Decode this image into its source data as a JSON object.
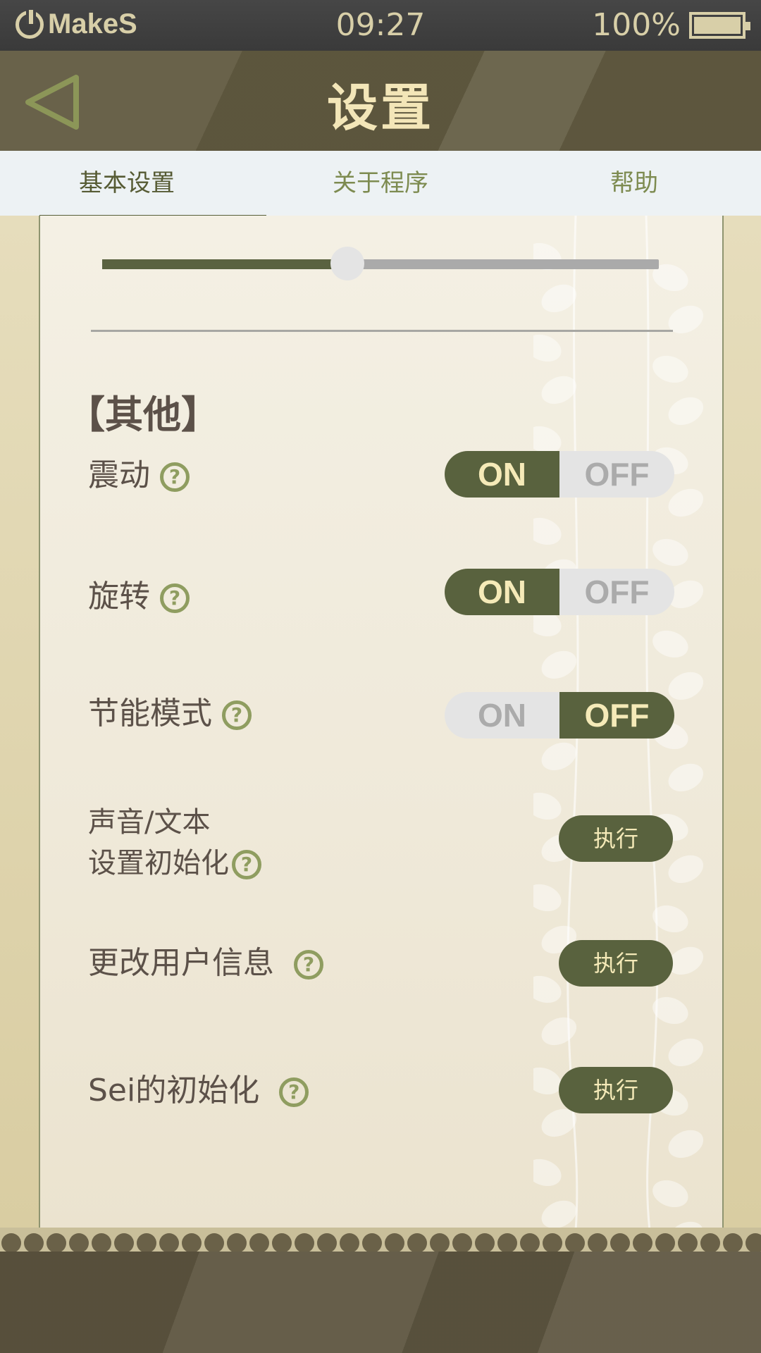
{
  "status_bar": {
    "brand": "MakeS",
    "time": "09:27",
    "battery": "100%",
    "battery_level": 1.0
  },
  "header": {
    "title": "设置",
    "back_icon": "back-triangle-icon"
  },
  "tabs": [
    {
      "label": "基本设置",
      "active": true
    },
    {
      "label": "关于程序",
      "active": false
    },
    {
      "label": "帮助",
      "active": false
    }
  ],
  "volume_slider": {
    "value": 0.44
  },
  "section": {
    "title": "【其他】"
  },
  "toggles": [
    {
      "label": "震动",
      "on_label": "ON",
      "off_label": "OFF",
      "state": "on"
    },
    {
      "label": "旋转",
      "on_label": "ON",
      "off_label": "OFF",
      "state": "on"
    },
    {
      "label": "节能模式",
      "on_label": "ON",
      "off_label": "OFF",
      "state": "off"
    }
  ],
  "actions": [
    {
      "label_line1": "声音/文本",
      "label_line2": "设置初始化",
      "button": "执行"
    },
    {
      "label": "更改用户信息",
      "button": "执行"
    },
    {
      "label": "Sei的初始化",
      "button": "执行"
    }
  ],
  "help_glyph": "?",
  "colors": {
    "accent": "#59623e",
    "accent_text": "#f5eab8",
    "header_bg": "#615a40",
    "tab_active": "#565b34",
    "tab_inactive": "#7d8b50",
    "help_icon": "#8f9d60"
  }
}
